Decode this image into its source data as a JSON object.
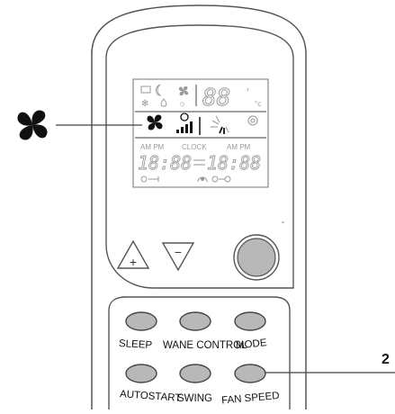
{
  "callout": {
    "number": "2"
  },
  "lcd": {
    "digits_top": "88",
    "am_pm_left": "AM PM",
    "clock_label": "CLOCK",
    "am_pm_right": "AM PM",
    "time_left": "18:88",
    "time_right": "18:88"
  },
  "buttons": {
    "plus": "+",
    "minus": "−",
    "sleep": "SLEEP",
    "wane_control": "WANE CONTROL",
    "mode": "MODE",
    "autostart": "AUTOSTART",
    "swing": "SWING",
    "fan_speed": "FAN SPEED"
  },
  "icons": {
    "external_fan": "fan-icon",
    "lcd_fan": "fan-icon",
    "lcd_speed_bars": "fan-speed-bars-icon"
  },
  "colors": {
    "outline": "#555555",
    "lcd_outline": "#888888",
    "lcd_text": "#9a9a9a",
    "lcd_active": "#111111",
    "button_fill": "#b8b8b8"
  }
}
